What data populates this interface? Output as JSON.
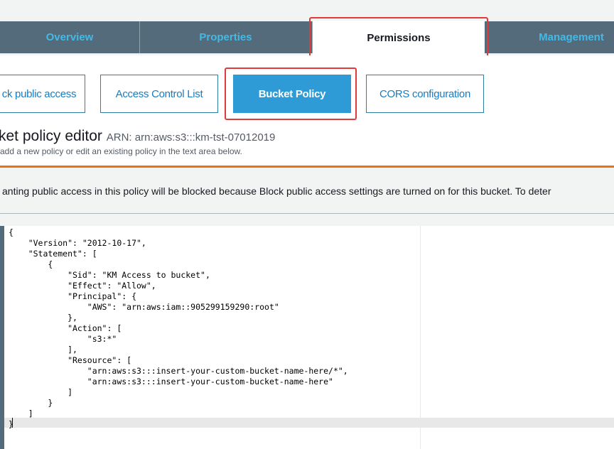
{
  "tabs": [
    {
      "label": "Overview"
    },
    {
      "label": "Properties"
    },
    {
      "label": "Permissions"
    },
    {
      "label": "Management"
    }
  ],
  "subtabs": [
    {
      "label": "ck public access"
    },
    {
      "label": "Access Control List"
    },
    {
      "label": "Bucket Policy"
    },
    {
      "label": "CORS configuration"
    }
  ],
  "editor": {
    "title": "ket policy editor",
    "arn": "ARN: arn:aws:s3:::km-tst-07012019",
    "subtitle": "add a new policy or edit an existing policy in the text area below."
  },
  "warning": {
    "text": "anting public access in this policy will be blocked because Block public access settings are turned on for this bucket. To deter"
  },
  "code": {
    "text": "{\n    \"Version\": \"2012-10-17\",\n    \"Statement\": [\n        {\n            \"Sid\": \"KM Access to bucket\",\n            \"Effect\": \"Allow\",\n            \"Principal\": {\n                \"AWS\": \"arn:aws:iam::905299159290:root\"\n            },\n            \"Action\": [\n                \"s3:*\"\n            ],\n            \"Resource\": [\n                \"arn:aws:s3:::insert-your-custom-bucket-name-here/*\",\n                \"arn:aws:s3:::insert-your-custom-bucket-name-here\"\n            ]\n        }\n    ]\n}"
  },
  "colors": {
    "tabbar": "#546b7b",
    "tab_text": "#44b9e6",
    "highlight": "#e23a3a",
    "active_subtab": "#2e9bd6",
    "warning_rule": "#ec7211"
  }
}
